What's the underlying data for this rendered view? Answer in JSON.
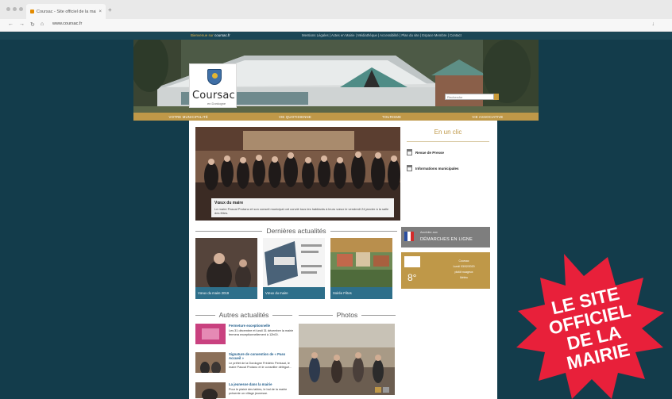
{
  "browser": {
    "tab_title": "Coursac - Site officiel de la mairie",
    "tab_close": "×",
    "new_tab": "+",
    "url": "www.coursac.fr",
    "nav_back": "←",
    "nav_forward": "→",
    "nav_reload": "↻",
    "nav_home": "⌂",
    "download_icon": "↓"
  },
  "site": {
    "topbar": {
      "brand_prefix": "Bienvenue sur",
      "brand_domain": "coursac.fr",
      "links": "Mentions Légales | Actes en Mairie | Médiathèque | Accessibilité | Plan du site | Espace Membre | Contact"
    },
    "logo": {
      "name": "Coursac",
      "subtitle": "en Dordogne"
    },
    "search_placeholder": "Recherche",
    "main_nav": [
      "VOTRE MUNICIPALITÉ",
      "VIE QUOTIDIENNE",
      "TOURISME",
      "VIE ASSOCIATIVE"
    ],
    "slider": {
      "title": "Vœux du maire",
      "text": "Le maire Pascal Protano et son conseil municipal ont convié tous les habitants à leurs vœux le vendredi 24 janvier à la salle des fêtes."
    },
    "en_un_clic": {
      "title": "En un clic",
      "items": [
        "Revue de Presse",
        "Informations municipales"
      ]
    },
    "demarches": {
      "small": "Accédez aux",
      "big": "DÉMARCHES EN LIGNE"
    },
    "meteo": {
      "temp": "8°",
      "lines": [
        "Coursac",
        "Lundi 03/02/2020",
        "plutôt nuageux",
        "Météo"
      ]
    },
    "dernieres": {
      "heading": "Dernières actualités",
      "cards": [
        "Vœux du maire 2019",
        "Vœux du maire",
        "Soirée Fêtes"
      ]
    },
    "autres": {
      "heading": "Autres actualités",
      "items": [
        {
          "title": "Fermeture exceptionnelle",
          "text": "Les 31 décembre et lundi 31 décembre la mairie fermera exceptionnellement à 12h00."
        },
        {
          "title": "Signature de convention de « Pass Accueil »",
          "text": "Le préfet de la Dordogne Frédéric Perissat, le maire Pascal Protano et le conseiller délégué..."
        },
        {
          "title": "La jeunesse dans la mairie",
          "text": "Pour le plaisir des tables, le bal de la mairie présente un village jeunesse."
        }
      ]
    },
    "photos": {
      "heading": "Photos"
    }
  },
  "burst": {
    "lines": [
      "LE SITE",
      "OFFICIEL",
      "DE LA",
      "MAIRIE"
    ],
    "color": "#e8203a"
  }
}
